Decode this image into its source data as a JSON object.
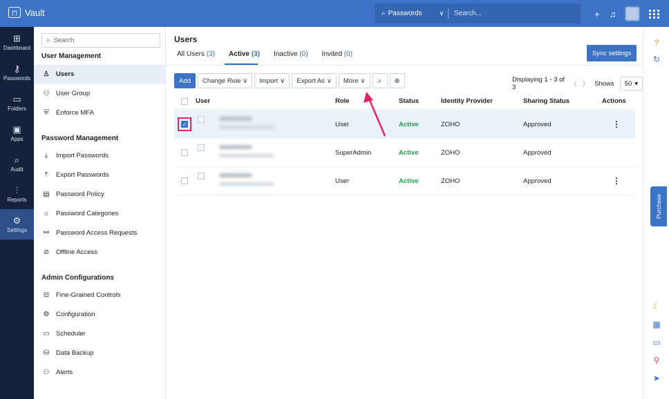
{
  "topbar": {
    "app_name": "Vault",
    "logo_text": "[*]",
    "search_scope": "Passwords",
    "search_placeholder": "Search..."
  },
  "rail": [
    {
      "label": "Dashboard",
      "icon": "dashboard-icon",
      "glyph": "⊞"
    },
    {
      "label": "Passwords",
      "icon": "key-icon",
      "glyph": "⚷"
    },
    {
      "label": "Folders",
      "icon": "folder-icon",
      "glyph": "▭"
    },
    {
      "label": "Apps",
      "icon": "apps-icon",
      "glyph": "▣"
    },
    {
      "label": "Audit",
      "icon": "audit-icon",
      "glyph": "⌕"
    },
    {
      "label": "Reports",
      "icon": "reports-icon",
      "glyph": "⫶"
    },
    {
      "label": "Settings",
      "icon": "settings-icon",
      "glyph": "⚙"
    }
  ],
  "subnav": {
    "search_placeholder": "Search",
    "sections": [
      {
        "title": "User Management",
        "items": [
          {
            "label": "Users",
            "icon": "user-icon",
            "glyph": "♙",
            "active": true
          },
          {
            "label": "User Group",
            "icon": "user-group-icon",
            "glyph": "⚇"
          },
          {
            "label": "Enforce MFA",
            "icon": "mfa-icon",
            "glyph": "⛨"
          }
        ]
      },
      {
        "title": "Password Management",
        "items": [
          {
            "label": "Import Passwords",
            "icon": "import-icon",
            "glyph": "⤓"
          },
          {
            "label": "Export Passwords",
            "icon": "export-icon",
            "glyph": "⤒"
          },
          {
            "label": "Password Policy",
            "icon": "policy-icon",
            "glyph": "▤"
          },
          {
            "label": "Password Categories",
            "icon": "categories-icon",
            "glyph": "⌂"
          },
          {
            "label": "Password Access Requests",
            "icon": "access-requests-icon",
            "glyph": "⚯"
          },
          {
            "label": "Offline Access",
            "icon": "offline-icon",
            "glyph": "⊘"
          }
        ]
      },
      {
        "title": "Admin Configurations",
        "items": [
          {
            "label": "Fine-Grained Controls",
            "icon": "controls-icon",
            "glyph": "⊟"
          },
          {
            "label": "Configuration",
            "icon": "gear-icon",
            "glyph": "⚙"
          },
          {
            "label": "Scheduler",
            "icon": "calendar-icon",
            "glyph": "▭"
          },
          {
            "label": "Data Backup",
            "icon": "backup-icon",
            "glyph": "⛁"
          },
          {
            "label": "Alerts",
            "icon": "alerts-icon",
            "glyph": "⚇"
          }
        ]
      }
    ]
  },
  "main": {
    "title": "Users",
    "tabs": [
      {
        "label": "All Users",
        "count": "(3)"
      },
      {
        "label": "Active",
        "count": "(3)",
        "active": true
      },
      {
        "label": "Inactive",
        "count": "(0)"
      },
      {
        "label": "Invited",
        "count": "(0)"
      }
    ],
    "sync_label": "Sync settings",
    "toolbar": {
      "add": "Add",
      "change_role": "Change Role",
      "import": "Import",
      "export_as": "Export As",
      "more": "More"
    },
    "displaying": "Displaying 1 - 3 of 3",
    "shows_label": "Shows",
    "shows_value": "50",
    "columns": [
      "User",
      "Role",
      "Status",
      "Identity Provider",
      "Sharing Status",
      "Actions"
    ],
    "rows": [
      {
        "role": "User",
        "status": "Active",
        "idp": "ZOHO",
        "sharing": "Approved",
        "checked": true,
        "actions": true
      },
      {
        "role": "SuperAdmin",
        "status": "Active",
        "idp": "ZOHO",
        "sharing": "Approved",
        "checked": false,
        "actions": false
      },
      {
        "role": "User",
        "status": "Active",
        "idp": "ZOHO",
        "sharing": "Approved",
        "checked": false,
        "actions": true
      }
    ]
  },
  "right_rail": {
    "purchase_label": "Purchase"
  },
  "colors": {
    "brand": "#3c73c6",
    "rail_bg": "#14223c",
    "active_status": "#1e9e4a",
    "annotation": "#e8235f"
  }
}
